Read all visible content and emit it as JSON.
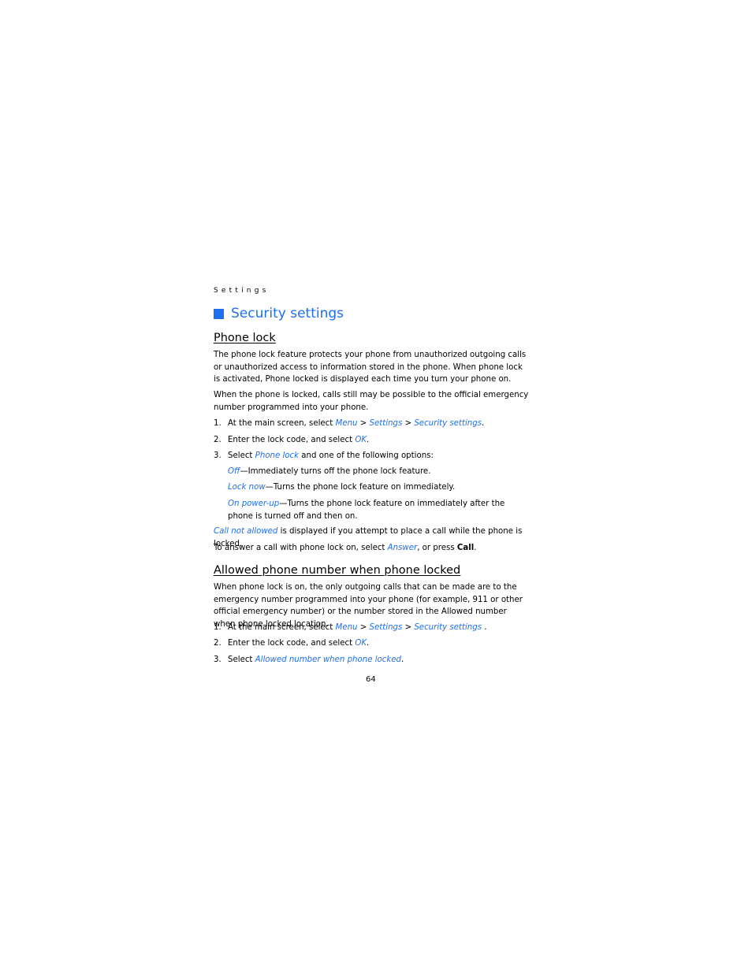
{
  "running_head": "Settings",
  "section_title": "Security settings",
  "accent_color": "#1e6ef0",
  "phone_lock": {
    "heading": "Phone lock",
    "para1": "The phone lock feature protects your phone from unauthorized outgoing calls or unauthorized access to information stored in the phone. When phone lock is activated, Phone locked is displayed each time you turn your phone on.",
    "para2": "When the phone is locked, calls still may be possible to the official emergency number programmed into your phone.",
    "steps": [
      {
        "num": "1.",
        "pre": "At the main screen, select ",
        "l1": "Menu",
        "s1": " > ",
        "l2": "Settings",
        "s2": " > ",
        "l3": "Security settings",
        "post": "."
      },
      {
        "num": "2.",
        "pre": "Enter the lock code, and select ",
        "l1": "OK",
        "post": "."
      },
      {
        "num": "3.",
        "pre": "Select ",
        "l1": "Phone lock",
        "post": " and one of the following options:"
      }
    ],
    "options": [
      {
        "label": "Off",
        "desc": "—Immediately turns off the phone lock feature."
      },
      {
        "label": "Lock now",
        "desc": "—Turns the phone lock feature on immediately."
      },
      {
        "label": "On power-up",
        "desc": "—Turns the phone lock feature on immediately after the phone is turned off and then on."
      }
    ],
    "note1": {
      "link": "Call not allowed",
      "text": " is displayed if you attempt to place a call while the phone is locked."
    },
    "note2": {
      "pre": "To answer a call with phone lock on, select ",
      "link": "Answer",
      "mid": ", or press ",
      "bold": "Call",
      "post": "."
    }
  },
  "allowed_number": {
    "heading": "Allowed phone number when phone locked",
    "para": "When phone lock is on, the only outgoing calls that can be made are to the emergency number programmed into your phone (for example, 911 or other official emergency number) or the number stored in the Allowed number when phone locked location.",
    "steps": [
      {
        "num": "1.",
        "pre": "At the main screen, select ",
        "l1": "Menu",
        "s1": " > ",
        "l2": "Settings",
        "s2": " > ",
        "l3": "Security settings",
        "post": " ."
      },
      {
        "num": "2.",
        "pre": "Enter the lock code, and select ",
        "l1": "OK",
        "post": "."
      },
      {
        "num": "3.",
        "pre": "Select ",
        "l1": "Allowed number when phone locked",
        "post": "."
      }
    ]
  },
  "page_number": "64"
}
